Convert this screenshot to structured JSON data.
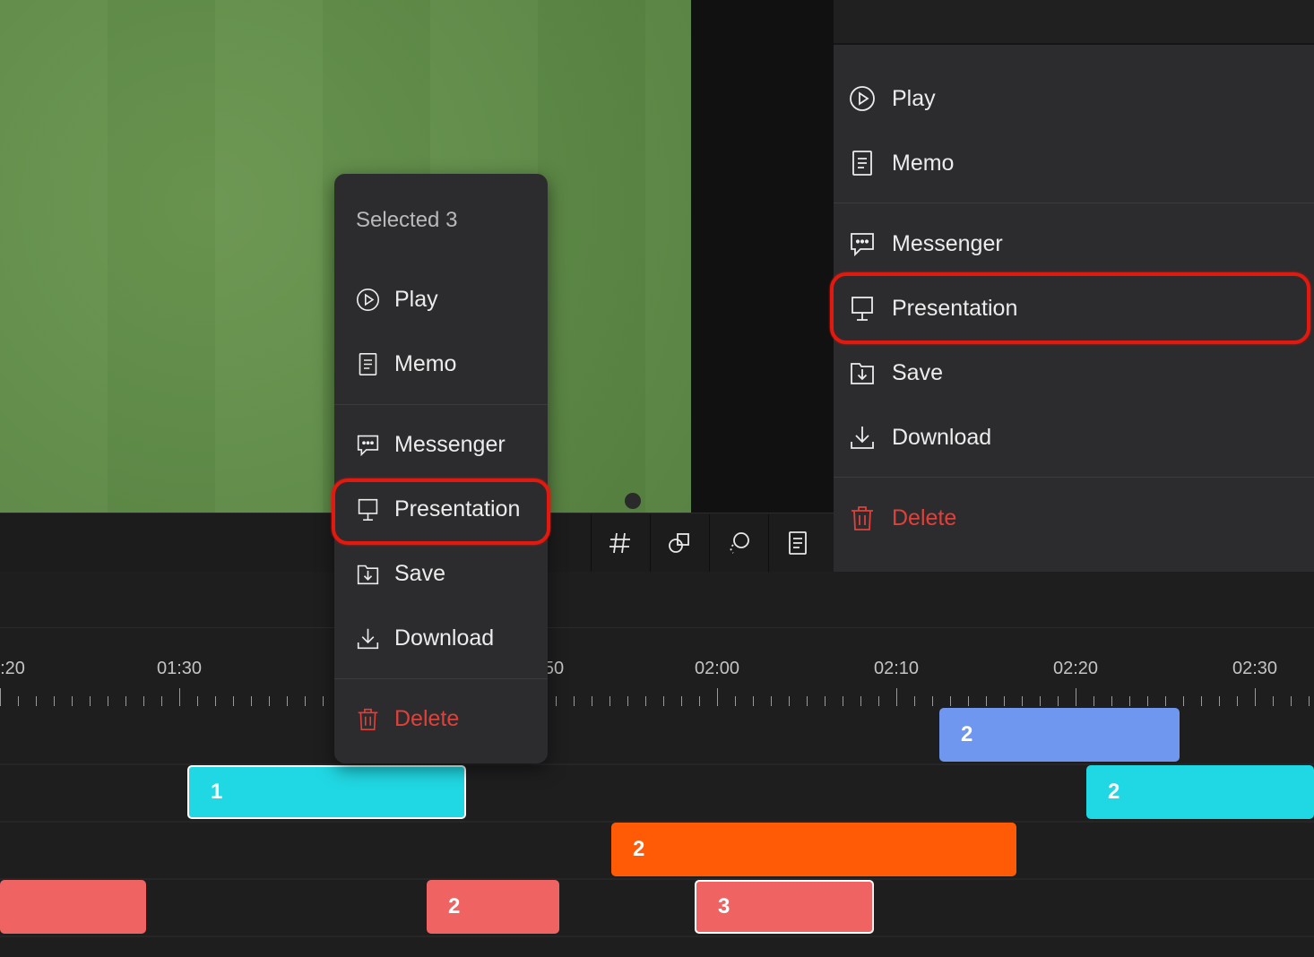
{
  "popup": {
    "header": "Selected 3",
    "items": [
      "Play",
      "Memo",
      "Messenger",
      "Presentation",
      "Save",
      "Download",
      "Delete"
    ],
    "highlighted": "Presentation"
  },
  "panel": {
    "items": [
      "Play",
      "Memo",
      "Messenger",
      "Presentation",
      "Save",
      "Download",
      "Delete"
    ],
    "highlighted": "Presentation"
  },
  "toolbar": {
    "icons": [
      "hash-icon",
      "shapes-icon",
      "lasso-icon",
      "memo-icon"
    ]
  },
  "timeline": {
    "ticks": [
      ":20",
      "01:30",
      "50",
      "02:00",
      "02:10",
      "02:20",
      "02:30"
    ],
    "clips": [
      {
        "label": "2",
        "color": "#6f97ef",
        "selected": false
      },
      {
        "label": "1",
        "color": "#20d8e3",
        "selected": true
      },
      {
        "label": "2",
        "color": "#20d8e3",
        "selected": false
      },
      {
        "label": "2",
        "color": "#ff5a05",
        "selected": false
      },
      {
        "label": "",
        "color": "#f06363",
        "selected": false
      },
      {
        "label": "2",
        "color": "#f06363",
        "selected": false
      },
      {
        "label": "3",
        "color": "#f06363",
        "selected": true
      }
    ]
  },
  "colors": {
    "danger": "#e0403a",
    "highlight_ring": "#e3190f",
    "panel_bg": "#2c2c2e"
  }
}
